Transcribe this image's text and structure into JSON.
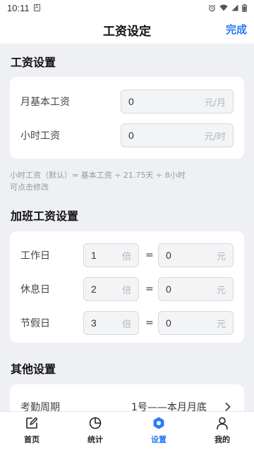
{
  "status_bar": {
    "time": "10:11",
    "notif_glyph": "A"
  },
  "header": {
    "title": "工资设定",
    "done_label": "完成"
  },
  "salary_section": {
    "title": "工资设置",
    "rows": [
      {
        "label": "月基本工资",
        "value": "0",
        "unit": "元/月"
      },
      {
        "label": "小时工资",
        "value": "0",
        "unit": "元/时"
      }
    ],
    "hint_line1": "小时工资（默认）= 基本工资 ÷ 21.75天 ÷ 8小时",
    "hint_line2": "可点击修改"
  },
  "overtime_section": {
    "title": "加班工资设置",
    "rows": [
      {
        "label": "工作日",
        "multiplier": "1",
        "multiplier_unit": "倍",
        "equals": "=",
        "value": "0",
        "unit": "元"
      },
      {
        "label": "休息日",
        "multiplier": "2",
        "multiplier_unit": "倍",
        "equals": "=",
        "value": "0",
        "unit": "元"
      },
      {
        "label": "节假日",
        "multiplier": "3",
        "multiplier_unit": "倍",
        "equals": "=",
        "value": "0",
        "unit": "元"
      }
    ]
  },
  "other_section": {
    "title": "其他设置",
    "rows": [
      {
        "label": "考勤周期",
        "value": "1号——本月月底"
      }
    ]
  },
  "tabbar": {
    "tabs": [
      {
        "label": "首页",
        "icon": "edit-icon"
      },
      {
        "label": "统计",
        "icon": "pie-chart-icon"
      },
      {
        "label": "设置",
        "icon": "settings-icon"
      },
      {
        "label": "我的",
        "icon": "user-icon"
      }
    ],
    "active_index": 2
  },
  "colors": {
    "accent": "#2b7cf6",
    "background": "#eef0f4",
    "card": "#ffffff"
  }
}
